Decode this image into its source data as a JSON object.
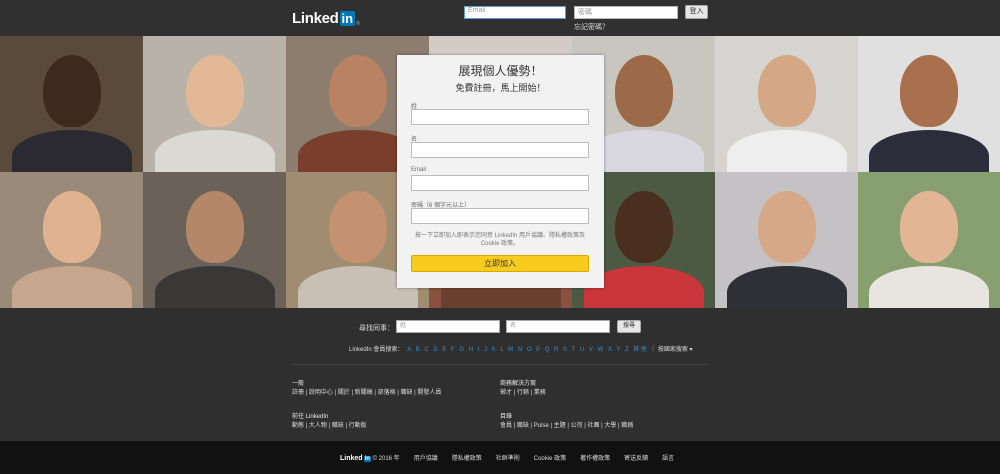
{
  "header": {
    "logo_text": "Linked",
    "logo_in": "in",
    "logo_reg": "®",
    "email_placeholder": "Email",
    "password_placeholder": "密碼",
    "login_label": "登入",
    "forgot_password": "忘記密碼？"
  },
  "signup": {
    "title": "展現個人優勢！",
    "subtitle": "免費註冊，馬上開始！",
    "fields": [
      {
        "label": "姓"
      },
      {
        "label": "名"
      },
      {
        "label": "Email"
      },
      {
        "label": "密碼（6 個字元以上）"
      }
    ],
    "terms": "按一下立即加入即表示您同意 LinkedIn 用戶協議、隱私權政策及 Cookie 政策。",
    "join_label": "立即加入"
  },
  "find": {
    "label": "尋找同事：",
    "first_placeholder": "姓",
    "last_placeholder": "名",
    "search_label": "搜尋"
  },
  "directory": {
    "label": "LinkedIn 會員搜索：",
    "letters": "A B C D E F G H I J K L M N O P Q R S T U V W X Y Z 其他",
    "country_label": "按國家搜索 ▾"
  },
  "footer": {
    "general_heading": "一般",
    "general_links": "註冊 | 說明中心 | 關於 | 新聞稿 | 部落格 | 職缺 | 開發人員",
    "business_heading": "商務解決方案",
    "business_links": "徵才 | 行銷 | 業務",
    "browse_heading": "前往 LinkedIn",
    "browse_links": "動態 | 大人物 | 職缺 | 行動版",
    "directories_heading": "目錄",
    "directories_links": "會員 | 職缺 | Pulse | 主題 | 公司 | 社團 | 大學 | 職稱"
  },
  "bottom": {
    "logo_text": "Linked",
    "logo_in": "in",
    "copyright": "© 2016 年",
    "links": [
      "用戶協議",
      "隱私權政策",
      "社群準則",
      "Cookie 政策",
      "著作權政策",
      "寄送反饋",
      "語言"
    ]
  },
  "colors": {
    "brand_blue": "#0077b5",
    "join_yellow": "#f8cc1f",
    "header_bg": "#303030"
  }
}
